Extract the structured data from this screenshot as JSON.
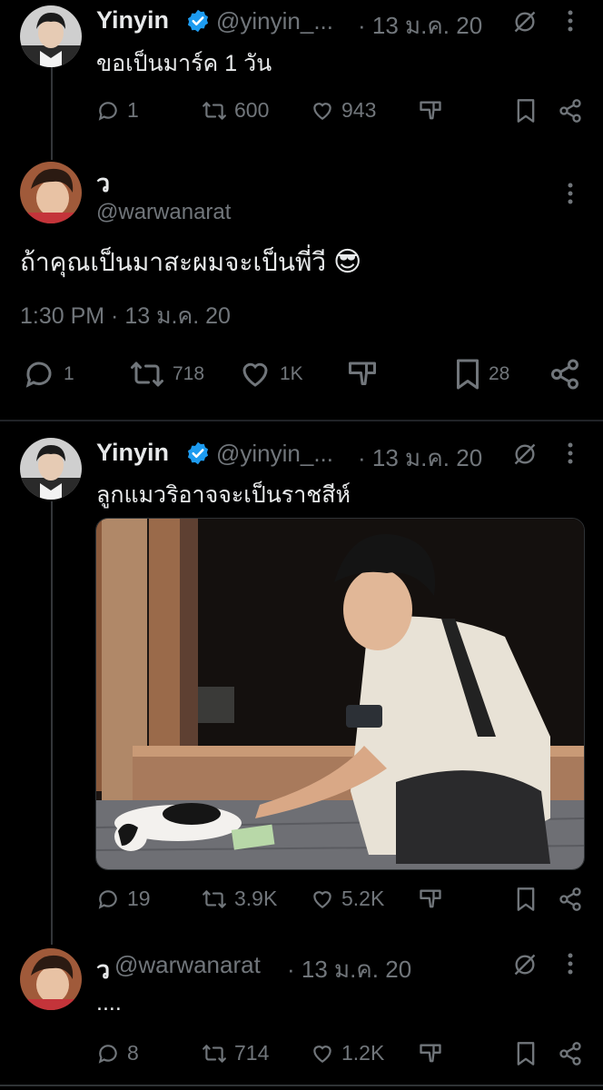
{
  "tweets": [
    {
      "name": "Yinyin",
      "handle": "@yinyin_...",
      "time": "· 13 ม.ค. 20",
      "text": "ขอเป็นมาร์ค 1 วัน",
      "replies": "1",
      "retweets": "600",
      "likes": "943"
    },
    {
      "name": "ว",
      "handle": "@warwanarat",
      "text": "ถ้าคุณเป็นมาสะผมจะเป็นพี่วี",
      "emoji": "😎",
      "timestamp": "1:30 PM · 13 ม.ค. 20",
      "replies": "1",
      "retweets": "718",
      "likes": "1K",
      "bookmarks": "28"
    },
    {
      "name": "Yinyin",
      "handle": "@yinyin_...",
      "time": "· 13 ม.ค. 20",
      "text": "ลูกแมวริอาจจะเป็นราชสีห์",
      "replies": "19",
      "retweets": "3.9K",
      "likes": "5.2K"
    },
    {
      "name": "ว",
      "handle": "@warwanarat",
      "time": "· 13 ม.ค. 20",
      "text": "....",
      "replies": "8",
      "retweets": "714",
      "likes": "1.2K"
    }
  ],
  "colors": {
    "background": "#000000",
    "text": "#e7e9ea",
    "secondary": "#71767b",
    "verified": "#1d9bf0",
    "divider": "#2f3336"
  }
}
